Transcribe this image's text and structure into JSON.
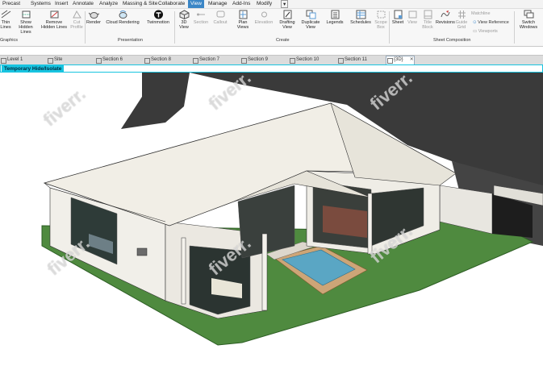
{
  "menu": [
    "Precast",
    "Systems",
    "Insert",
    "Annotate",
    "Analyze",
    "Massing & Site",
    "Collaborate",
    "View",
    "Manage",
    "Add-Ins",
    "Modify"
  ],
  "menu_active": "View",
  "ribbon": {
    "thin_lines": "Thin Lines",
    "show_hidden": "Show Hidden Lines",
    "remove_hidden": "Remove Hidden Lines",
    "cut_profile": "Cut Profile",
    "render": "Render",
    "cloud_rendering": "Cloud Rendering",
    "twinmotion": "Twinmotion",
    "view_3d": "3D View",
    "section": "Section",
    "callout": "Callout",
    "plan_views": "Plan Views",
    "elevation": "Elevation",
    "drafting_view": "Drafting View",
    "duplicate_view": "Duplicate View",
    "legends": "Legends",
    "schedules": "Schedules",
    "scope_box": "Scope Box",
    "sheet": "Sheet",
    "view": "View",
    "title_block": "Title Block",
    "revisions": "Revisions",
    "guide_grid": "Guide Grid",
    "matchline": "Matchline",
    "view_reference": "View Reference",
    "viewports": "Viewports",
    "switch_windows": "Switch Windows",
    "groups": {
      "graphics": "Graphics",
      "presentation": "Presentation",
      "create": "Create",
      "sheet_composition": "Sheet Composition"
    }
  },
  "tabs": [
    {
      "label": "Level 1"
    },
    {
      "label": "Site"
    },
    {
      "label": "Section 6"
    },
    {
      "label": "Section 8"
    },
    {
      "label": "Section 7"
    },
    {
      "label": "Section 9"
    },
    {
      "label": "Section 10"
    },
    {
      "label": "Section 11"
    },
    {
      "label": "{3D}",
      "active": true
    }
  ],
  "banner": "Temporary Hide/Isolate",
  "watermark": "fiverr.",
  "colors": {
    "accent": "#18c4e0",
    "asphalt": "#3a3a3a",
    "lawn": "#4f8a3f",
    "wall": "#f1efe9",
    "roof": "#f1eee6",
    "pool_water": "#5aa6c4",
    "pool_deck": "#cda577"
  }
}
